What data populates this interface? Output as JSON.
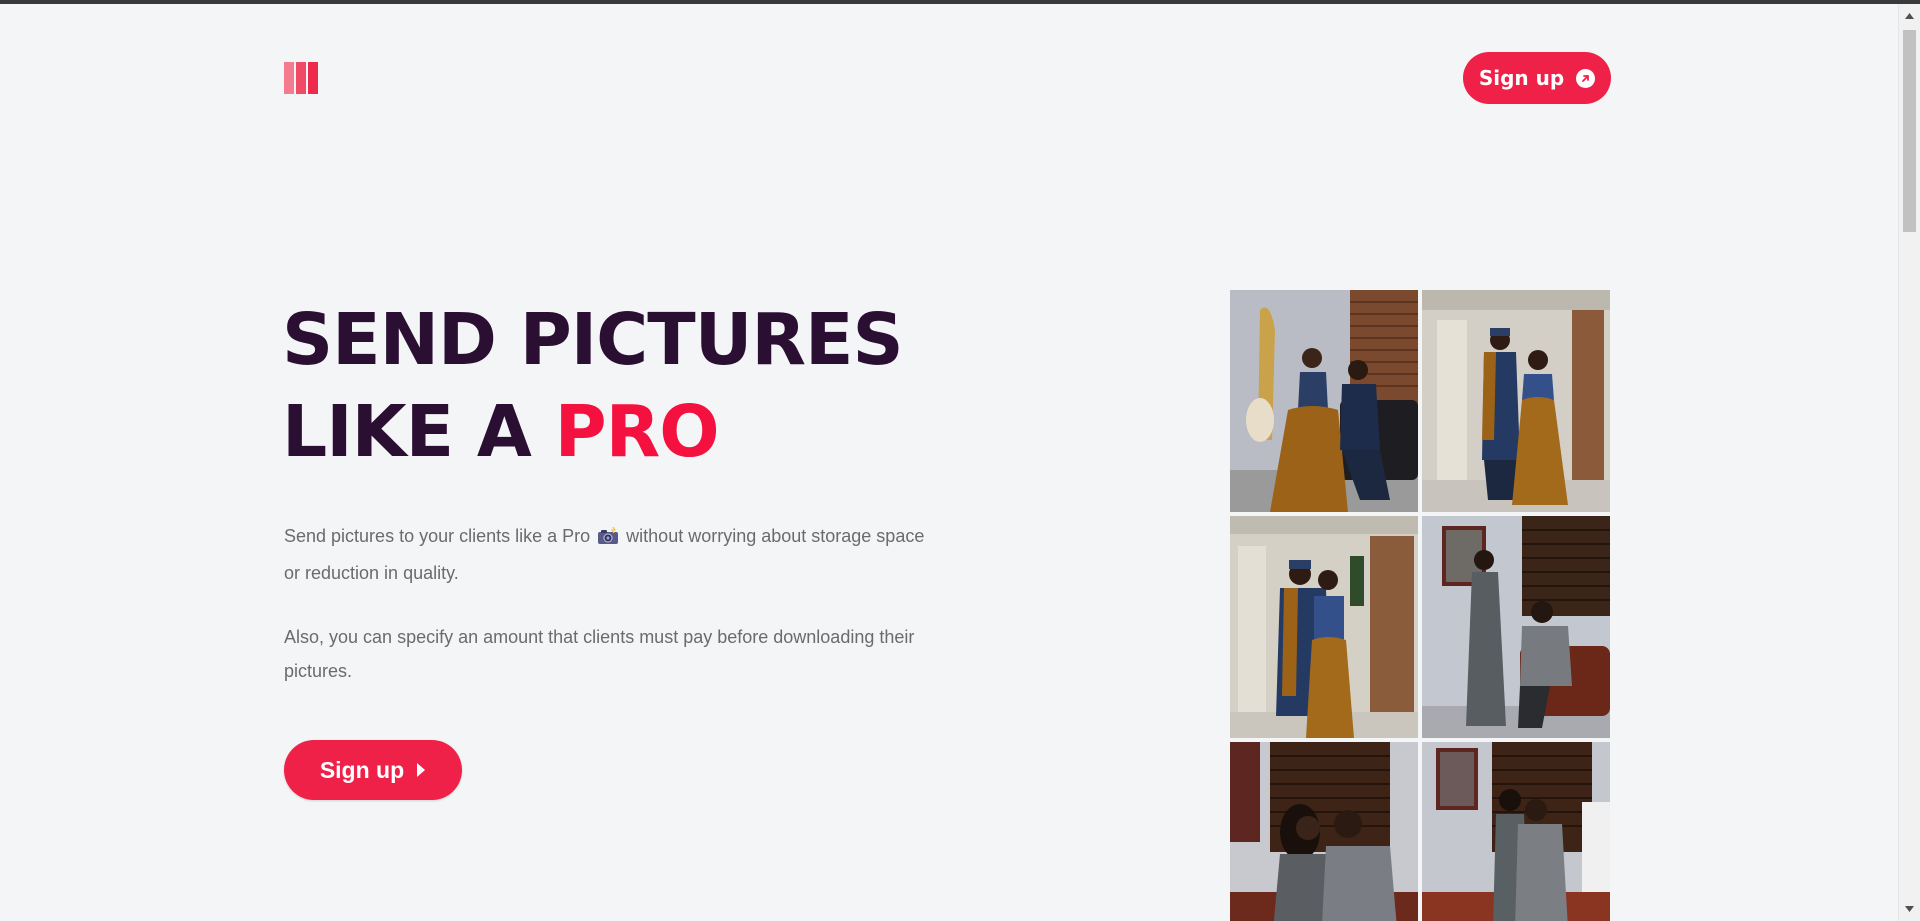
{
  "header": {
    "logo_alt": "app-logo",
    "signup_label": "Sign up"
  },
  "hero": {
    "headline_line1": "SEND PICTURES",
    "headline_line2_prefix": "LIKE A ",
    "headline_line2_accent": "PRO",
    "desc1_before": "Send pictures to your clients like a Pro",
    "desc1_after": " without worrying about storage space or reduction in quality.",
    "desc2": "Also, you can specify an amount that clients must pay before downloading their pictures.",
    "signup_label": "Sign up"
  },
  "gallery": {
    "photos": [
      {
        "name": "couple-photo-1"
      },
      {
        "name": "couple-photo-2"
      },
      {
        "name": "couple-photo-3"
      },
      {
        "name": "couple-photo-4"
      },
      {
        "name": "couple-photo-5"
      },
      {
        "name": "couple-photo-6"
      }
    ]
  },
  "colors": {
    "accent": "#ef2148",
    "headline": "#2b0f33",
    "pro": "#f5113f",
    "body_text": "#6b6b6b",
    "background": "#f4f5f7"
  }
}
